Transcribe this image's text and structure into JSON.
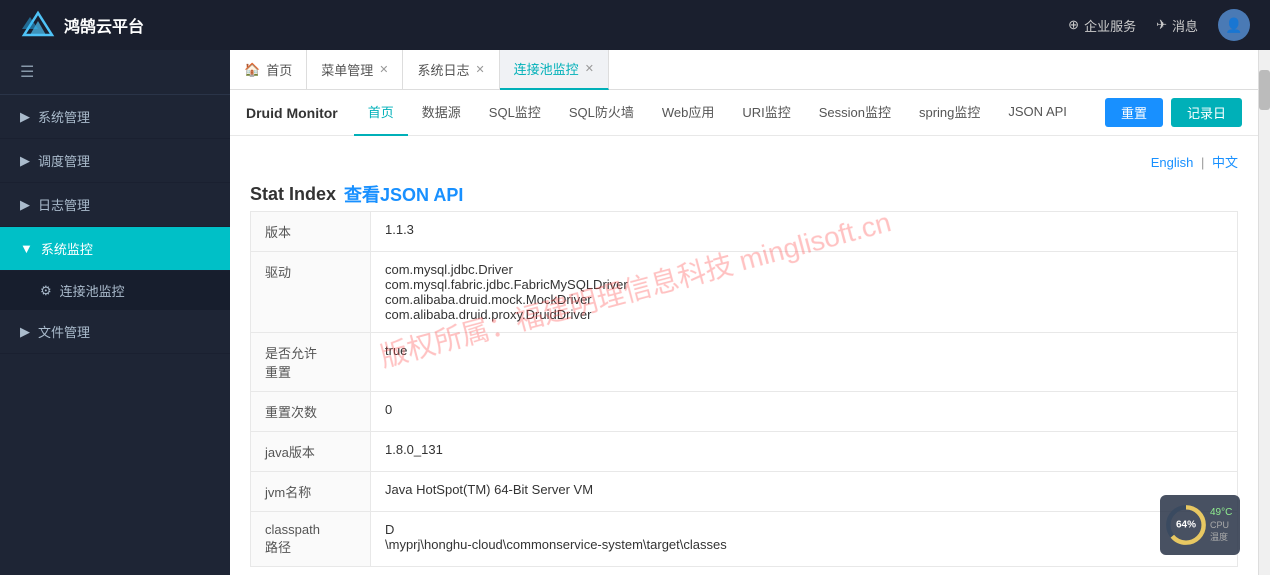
{
  "header": {
    "logo_text": "鸿鹄云平台",
    "enterprise_label": "企业服务",
    "message_label": "消息"
  },
  "sidebar": {
    "collapse_icon": "☰",
    "items": [
      {
        "id": "system-mgmt",
        "label": "系统管理",
        "expanded": false
      },
      {
        "id": "schedule-mgmt",
        "label": "调度管理",
        "expanded": false
      },
      {
        "id": "log-mgmt",
        "label": "日志管理",
        "expanded": false
      },
      {
        "id": "system-monitor",
        "label": "系统监控",
        "expanded": true,
        "active": true
      },
      {
        "id": "file-mgmt",
        "label": "文件管理",
        "expanded": false
      }
    ],
    "sub_items": [
      {
        "id": "conn-pool-monitor",
        "label": "连接池监控",
        "icon": "⚙"
      }
    ]
  },
  "tabs": [
    {
      "id": "home",
      "label": "首页",
      "icon": "🏠",
      "closable": false
    },
    {
      "id": "menu-mgmt",
      "label": "菜单管理",
      "closable": true
    },
    {
      "id": "system-log",
      "label": "系统日志",
      "closable": true
    },
    {
      "id": "conn-pool",
      "label": "连接池监控",
      "closable": true,
      "active": true
    }
  ],
  "druid": {
    "title": "Druid Monitor",
    "nav_items": [
      {
        "id": "home",
        "label": "首页",
        "active": true
      },
      {
        "id": "datasource",
        "label": "数据源"
      },
      {
        "id": "sql-monitor",
        "label": "SQL监控"
      },
      {
        "id": "sql-firewall",
        "label": "SQL防火墙"
      },
      {
        "id": "web-app",
        "label": "Web应用"
      },
      {
        "id": "uri-monitor",
        "label": "URI监控"
      },
      {
        "id": "session-monitor",
        "label": "Session监控"
      },
      {
        "id": "spring-monitor",
        "label": "spring监控"
      },
      {
        "id": "json-api",
        "label": "JSON API"
      }
    ],
    "btn_reset": "重置",
    "btn_record": "记录日"
  },
  "stat_index": {
    "title": "Stat Index",
    "json_api_link": "查看JSON API",
    "lang_en": "English",
    "lang_divider": "|",
    "lang_cn": "中文"
  },
  "stats": [
    {
      "label": "版本",
      "value": "1.1.3"
    },
    {
      "label": "驱动",
      "value": "com.mysql.jdbc.Driver\ncom.mysql.fabric.jdbc.FabricMySQLDriver\ncom.alibaba.druid.mock.MockDriver\ncom.alibaba.druid.proxy.DruidDriver"
    },
    {
      "label": "是否允许\n重置",
      "value": "true"
    },
    {
      "label": "重置次数",
      "value": "0"
    },
    {
      "label": "java版本",
      "value": "1.8.0_131"
    },
    {
      "label": "jvm名称",
      "value": "Java HotSpot(TM) 64-Bit Server VM"
    },
    {
      "label": "classpath\n路径",
      "value": "D\n\\myprj\\honghu-cloud\\commonservice-system\\target\\classes"
    }
  ],
  "cpu_widget": {
    "percentage": "64%",
    "temperature": "49°C",
    "label": "CPU温度",
    "circle_pct": 64
  },
  "watermark": {
    "text": "版权所属：福建明理信息科技  minglisoft.cn"
  }
}
